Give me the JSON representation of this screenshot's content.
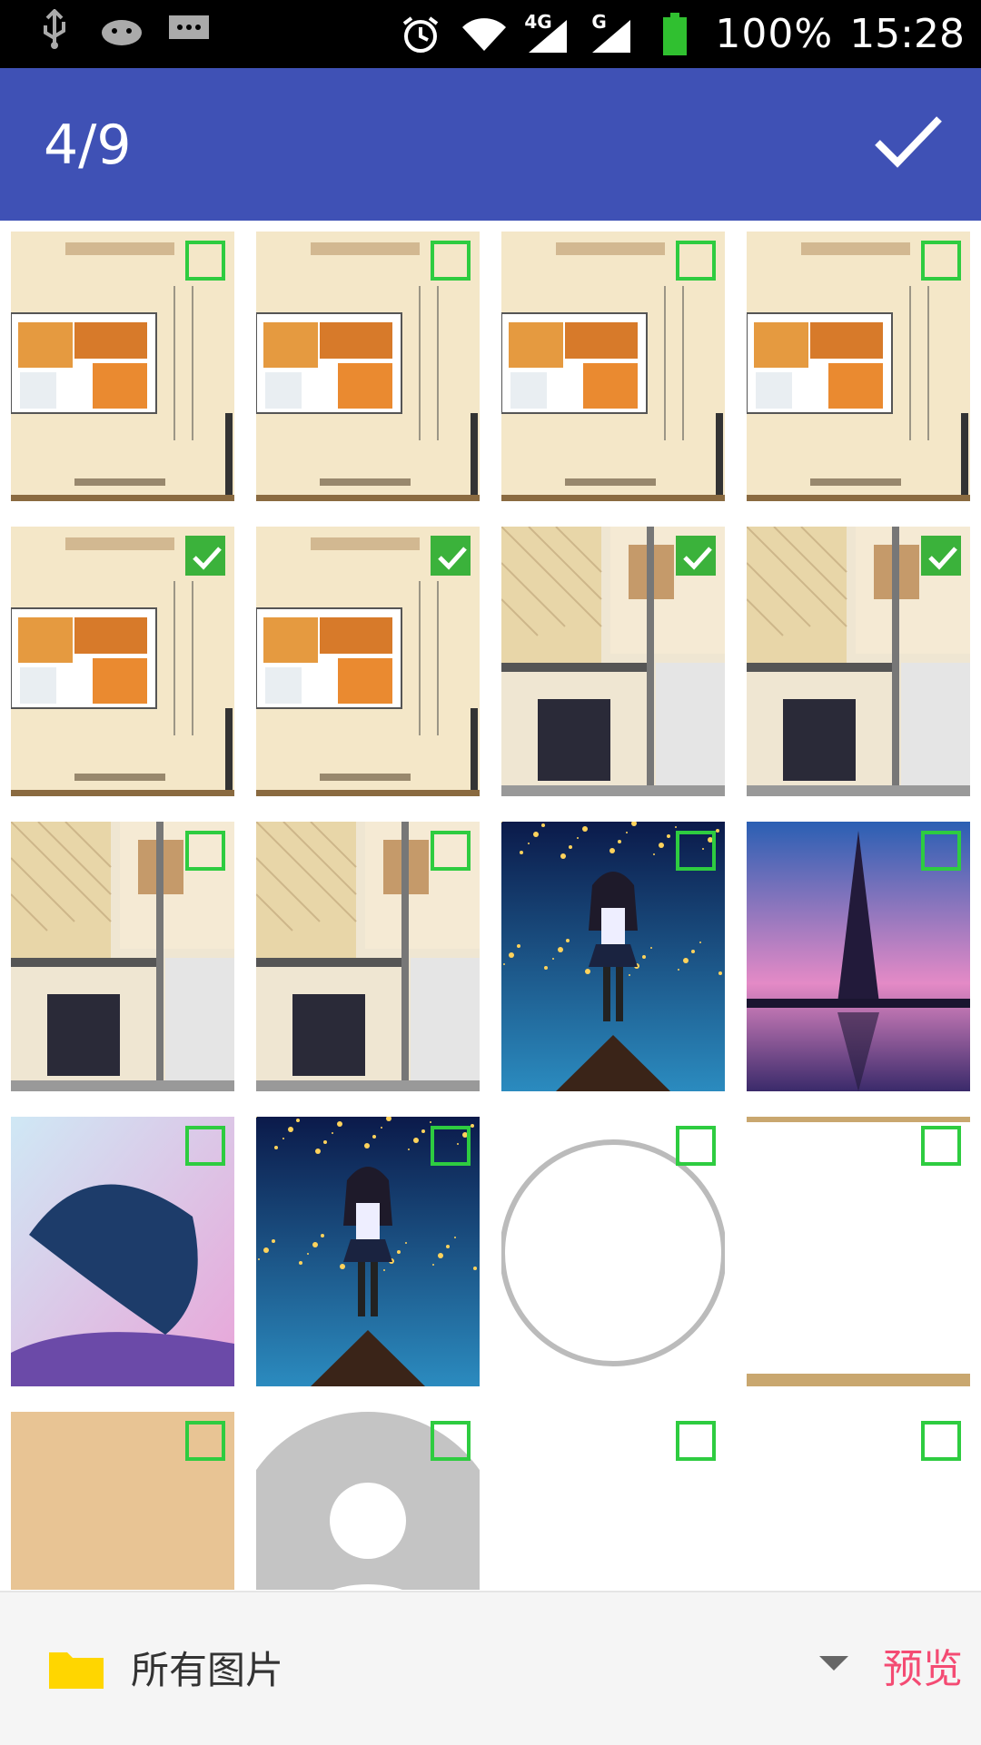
{
  "status_bar": {
    "battery_percent": "100%",
    "time": "15:28",
    "network_4g": "4G",
    "network_g": "G"
  },
  "header": {
    "counter": "4/9"
  },
  "grid": {
    "items": [
      {
        "name": "floorplan-1",
        "checked": false
      },
      {
        "name": "floorplan-2",
        "checked": false
      },
      {
        "name": "floorplan-3",
        "checked": false
      },
      {
        "name": "floorplan-4",
        "checked": false
      },
      {
        "name": "floorplan-5",
        "checked": true
      },
      {
        "name": "floorplan-6",
        "checked": true
      },
      {
        "name": "floorplan-closeup-1",
        "checked": true
      },
      {
        "name": "floorplan-closeup-2",
        "checked": true
      },
      {
        "name": "floorplan-closeup-3",
        "checked": false
      },
      {
        "name": "floorplan-closeup-4",
        "checked": false
      },
      {
        "name": "anime-girl-stars-1",
        "checked": false
      },
      {
        "name": "eiffel-tower-sunset",
        "checked": false
      },
      {
        "name": "abstract-whale",
        "checked": false
      },
      {
        "name": "anime-girl-stars-2",
        "checked": false
      },
      {
        "name": "white-circle",
        "checked": false
      },
      {
        "name": "white-frame",
        "checked": false
      },
      {
        "name": "tan-block",
        "checked": false
      },
      {
        "name": "default-avatar",
        "checked": false
      },
      {
        "name": "blank-white-1",
        "checked": false
      },
      {
        "name": "blank-white-2",
        "checked": false
      }
    ]
  },
  "bottom_bar": {
    "album_label": "所有图片",
    "preview_label": "预览"
  },
  "colors": {
    "app_bar": "#3F51B5",
    "checkbox": "#2ECC40",
    "preview": "#F44B73"
  }
}
